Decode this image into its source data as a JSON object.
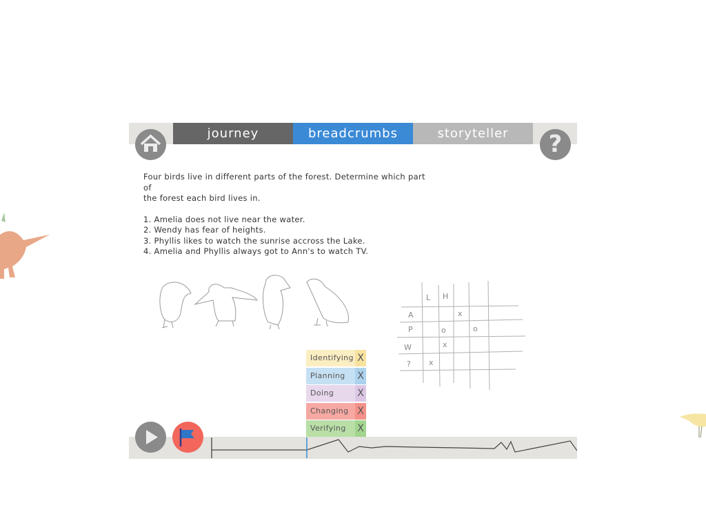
{
  "tabs": {
    "journey": "journey",
    "breadcrumbs": "breadcrumbs",
    "storyteller": "storyteller",
    "active": "breadcrumbs"
  },
  "help_label": "?",
  "puzzle": {
    "intro_line1": "Four birds live in different parts of the forest. Determine which part of",
    "intro_line2": "the forest each bird lives in.",
    "clues": [
      "1. Amelia does not live near the water.",
      "2. Wendy has fear of heights.",
      "3. Phyllis likes to watch the sunrise accross the Lake.",
      "4. Amelia and Phyllis always got to Ann's to watch TV."
    ]
  },
  "grid_sketch": {
    "col_headers": [
      "L",
      "H"
    ],
    "row_headers": [
      "A",
      "P",
      "W",
      "?"
    ],
    "marks": [
      "x",
      "o",
      "o",
      "x",
      "x"
    ]
  },
  "stages": [
    {
      "label": "Identifying",
      "remove": "X",
      "color": "#fbeec2",
      "x_color": "#f7e2a0"
    },
    {
      "label": "Planning",
      "remove": "X",
      "color": "#c6e0f3",
      "x_color": "#acd2ee"
    },
    {
      "label": "Doing",
      "remove": "X",
      "color": "#e7d8ec",
      "x_color": "#dcc6e4"
    },
    {
      "label": "Changing",
      "remove": "X",
      "color": "#f6a9a3",
      "x_color": "#f39188"
    },
    {
      "label": "Verifying",
      "remove": "X",
      "color": "#b9dfa7",
      "x_color": "#a2d58d"
    }
  ],
  "colors": {
    "tab_journey": "#666666",
    "tab_breadcrumbs": "#3a8ad6",
    "tab_storyteller": "#b8b8b8",
    "button_gray": "#8a8a8a",
    "flag_button": "#f2665c",
    "bar_bg": "#e4e3df"
  },
  "icons": {
    "home": "home-icon",
    "help": "question-icon",
    "play": "play-icon",
    "flag": "flag-icon"
  }
}
